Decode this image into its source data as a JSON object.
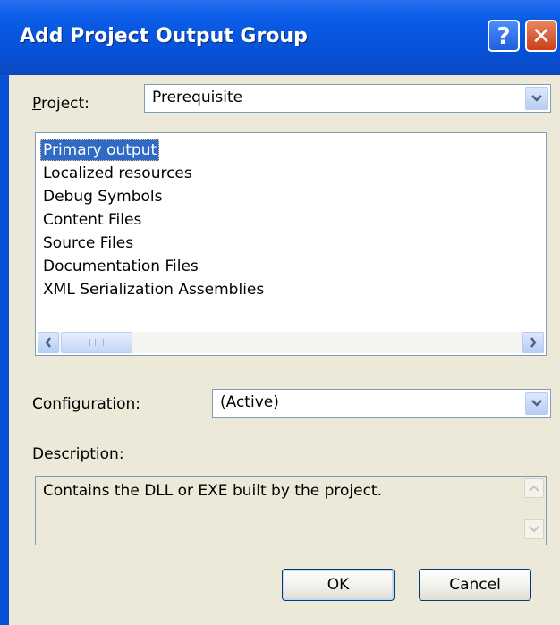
{
  "window": {
    "title": "Add Project Output Group",
    "help_label": "?",
    "close_label": "✕"
  },
  "project": {
    "label_accel": "P",
    "label_rest": "roject:",
    "value": "Prerequisite"
  },
  "output_list": {
    "items": [
      {
        "label": "Primary output",
        "selected": true
      },
      {
        "label": "Localized resources"
      },
      {
        "label": "Debug Symbols"
      },
      {
        "label": "Content Files"
      },
      {
        "label": "Source Files"
      },
      {
        "label": "Documentation Files"
      },
      {
        "label": "XML Serialization Assemblies"
      }
    ]
  },
  "configuration": {
    "label_accel": "C",
    "label_rest": "onfiguration:",
    "value": "(Active)"
  },
  "description": {
    "label_accel": "D",
    "label_rest": "escription:",
    "text": "Contains the DLL or EXE built by the project."
  },
  "buttons": {
    "ok_label": "OK",
    "cancel_label": "Cancel"
  },
  "colors": {
    "titlebar": "#0a5ce6",
    "selection": "#316ac5",
    "face": "#ece9d8"
  }
}
